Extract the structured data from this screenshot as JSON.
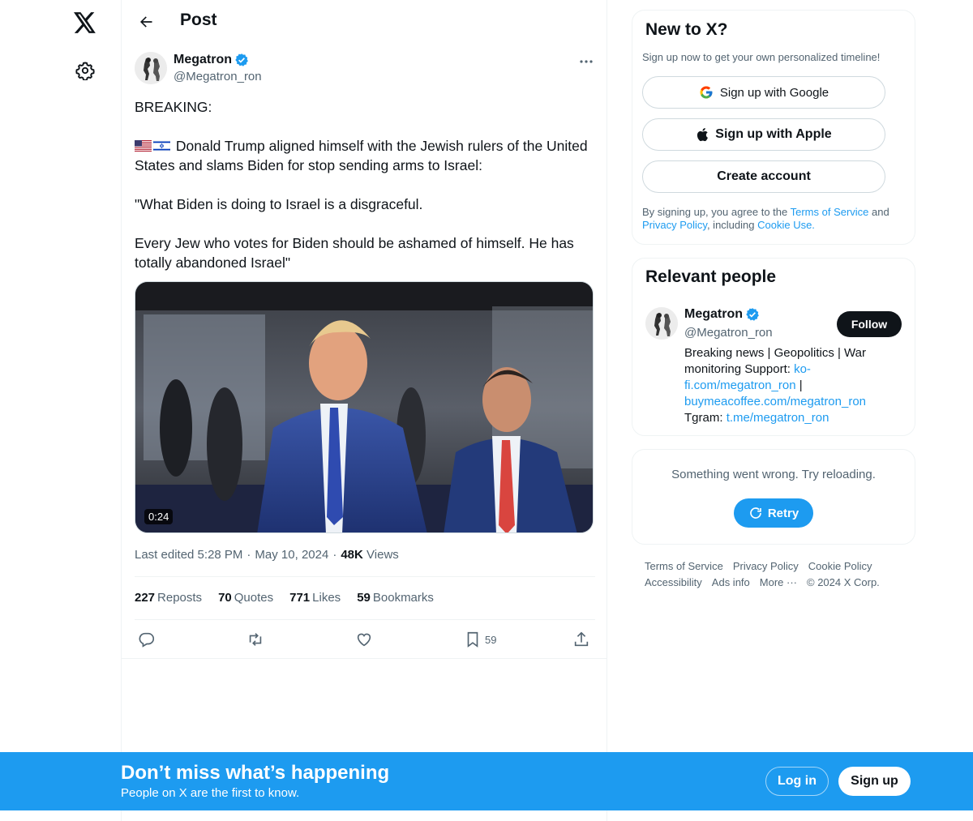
{
  "header": {
    "title": "Post"
  },
  "post": {
    "author": {
      "name": "Megatron",
      "handle": "@Megatron_ron"
    },
    "text": {
      "line1": "BREAKING:",
      "line2": "Donald Trump aligned himself with the Jewish rulers of the United States and slams Biden for stop sending arms to Israel:",
      "line3": "\"What Biden is doing to Israel is a disgraceful.",
      "line4": "Every Jew who votes for Biden should be ashamed of himself. He has totally abandoned Israel\""
    },
    "media": {
      "duration": "0:24"
    },
    "meta": {
      "edited": "Last edited 5:28 PM",
      "date": "May 10, 2024",
      "views_count": "48K",
      "views_label": "Views",
      "sep": "·"
    },
    "stats": {
      "reposts_count": "227",
      "reposts_label": "Reposts",
      "quotes_count": "70",
      "quotes_label": "Quotes",
      "likes_count": "771",
      "likes_label": "Likes",
      "bookmarks_count": "59",
      "bookmarks_label": "Bookmarks"
    },
    "actions": {
      "bookmark_count": "59"
    }
  },
  "signup_card": {
    "title": "New to X?",
    "subtitle": "Sign up now to get your own personalized timeline!",
    "google": "Sign up with Google",
    "apple": "Sign up with Apple",
    "create": "Create account",
    "legal_1": "By signing up, you agree to the ",
    "terms": "Terms of Service",
    "legal_2": " and ",
    "privacy": "Privacy Policy",
    "legal_3": ", including ",
    "cookie": "Cookie Use."
  },
  "relevant_people": {
    "title": "Relevant people",
    "name": "Megatron",
    "handle": "@Megatron_ron",
    "follow": "Follow",
    "bio_1": "Breaking news | Geopolitics | War monitoring Support: ",
    "bio_link1": "ko-fi.com/megatron_ron",
    "bio_2": " | ",
    "bio_link2": "buymeacoffee.com/megatron_ron",
    "bio_3": " Tgram: ",
    "bio_link3": "t.me/megatron_ron"
  },
  "error_card": {
    "message": "Something went wrong. Try reloading.",
    "retry": "Retry"
  },
  "footer": {
    "links": [
      "Terms of Service",
      "Privacy Policy",
      "Cookie Policy",
      "Accessibility",
      "Ads info",
      "More ···"
    ],
    "copyright": "© 2024 X Corp."
  },
  "banner": {
    "title": "Don’t miss what’s happening",
    "subtitle": "People on X are the first to know.",
    "login": "Log in",
    "signup": "Sign up"
  },
  "colors": {
    "accent": "#1d9bf0",
    "text": "#0f1419",
    "muted": "#536471",
    "border": "#eff3f4"
  }
}
